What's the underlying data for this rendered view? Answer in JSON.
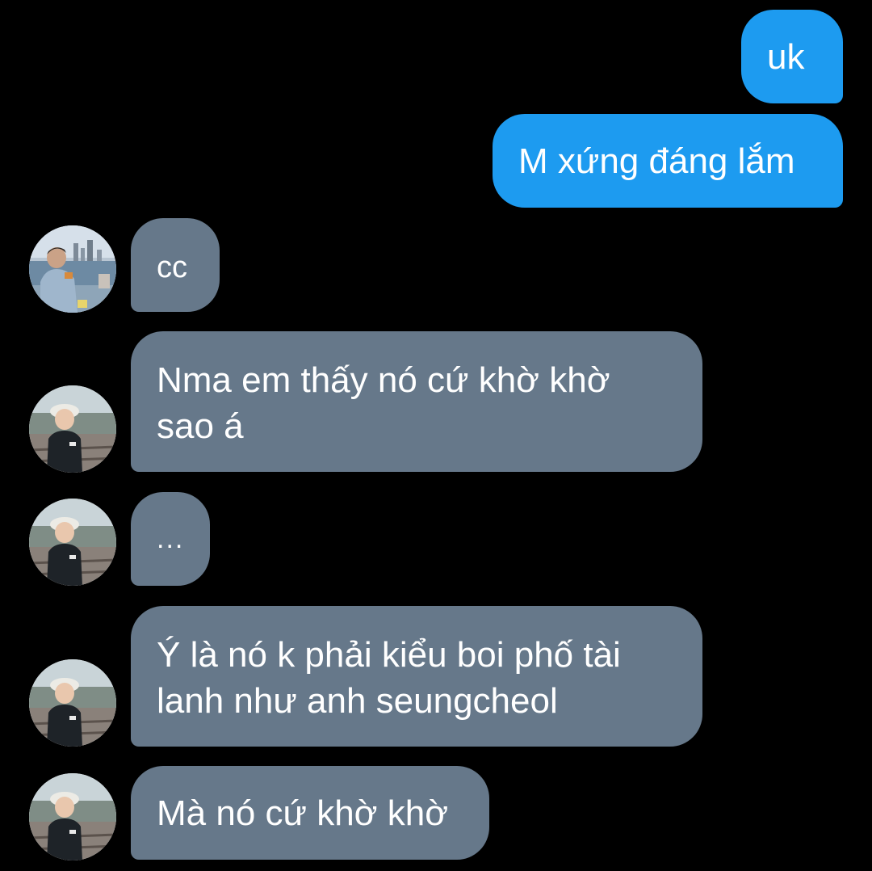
{
  "conversation": {
    "messages": [
      {
        "direction": "outgoing",
        "text": "uk"
      },
      {
        "direction": "outgoing",
        "text": "M xứng đáng lắm"
      },
      {
        "direction": "incoming",
        "text": "cc",
        "avatar": "user-photo-avatar-icon"
      },
      {
        "direction": "incoming",
        "text": "Nma em thấy nó cứ khờ khờ\nsao á",
        "avatar": "child-photo-avatar-icon"
      },
      {
        "direction": "incoming",
        "text": "...",
        "avatar": "child-photo-avatar-icon"
      },
      {
        "direction": "incoming",
        "text": "Ý là nó k phải kiểu boi phố tài\nlanh như anh seungcheol",
        "avatar": "child-photo-avatar-icon"
      },
      {
        "direction": "incoming",
        "text": "Mà nó cứ khờ khờ",
        "avatar": "child-photo-avatar-icon"
      }
    ]
  },
  "colors": {
    "background": "#000000",
    "outgoing_bubble": "#1d9bf0",
    "incoming_bubble": "#66788a",
    "text": "#ffffff"
  }
}
